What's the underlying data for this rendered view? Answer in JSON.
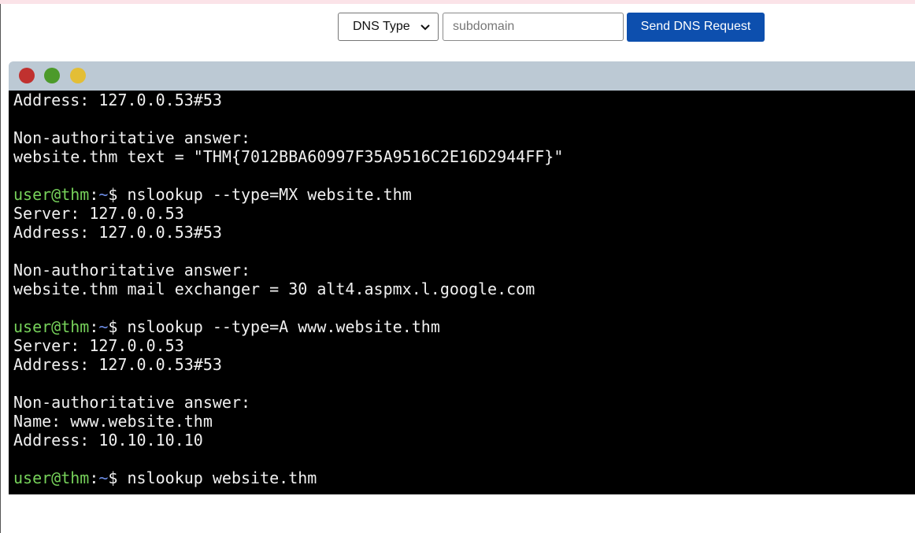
{
  "controls": {
    "dns_type_label": "DNS Type",
    "subdomain_placeholder": "subdomain",
    "send_button_label": "Send DNS Request"
  },
  "terminal": {
    "prompt": {
      "user_host": "user@thm",
      "colon": ":",
      "path": "~",
      "dollar": "$"
    },
    "lines": [
      "Address: 127.0.0.53#53",
      "",
      "Non-authoritative answer:",
      "website.thm text = \"THM{7012BBA60997F35A9516C2E16D2944FF}\"",
      "",
      " nslookup --type=MX website.thm",
      "Server: 127.0.0.53",
      "Address: 127.0.0.53#53",
      "",
      "Non-authoritative answer:",
      "website.thm mail exchanger = 30 alt4.aspmx.l.google.com",
      "",
      " nslookup --type=A www.website.thm",
      "Server: 127.0.0.53",
      "Address: 127.0.0.53#53",
      "",
      "Non-authoritative answer:",
      "Name: www.website.thm",
      "Address: 10.10.10.10",
      "",
      " nslookup website.thm"
    ]
  },
  "colors": {
    "button_bg": "#0d4fae",
    "titlebar_bg": "#bcc9d4",
    "prompt_user": "#76d15a",
    "prompt_path": "#6d8de6",
    "dot_red": "#c0312f",
    "dot_green": "#4c9a2a",
    "dot_yellow": "#e3be36"
  }
}
